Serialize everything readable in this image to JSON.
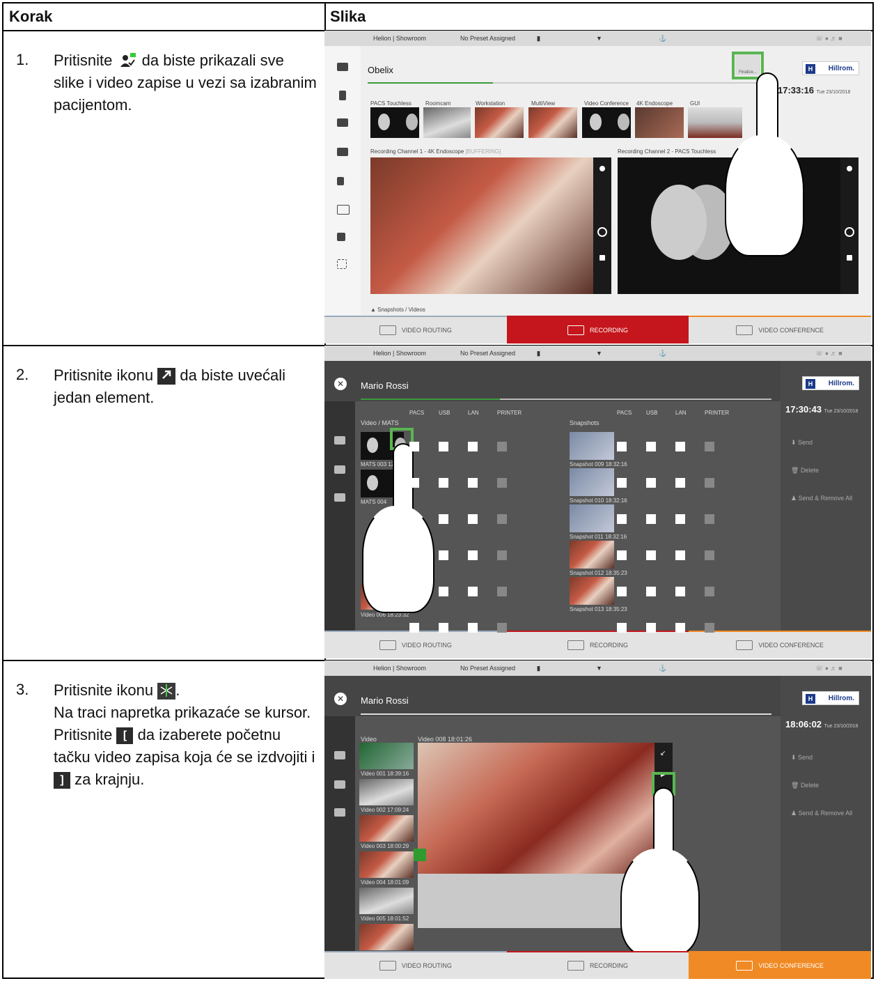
{
  "header": {
    "col_step": "Korak",
    "col_image": "Slika"
  },
  "rows": [
    {
      "num": "1.",
      "text_a": "Pritisnite",
      "text_b": "da biste prikazali sve slike i video zapise u vezi sa izabranim pacijentom.",
      "icon_label": "Finalize..."
    },
    {
      "num": "2.",
      "text_a": "Pritisnite ikonu",
      "text_b": "da biste uvećali jedan element."
    },
    {
      "num": "3.",
      "text_a": "Pritisnite ikonu",
      "text_b": ".",
      "text_c": "Na traci napretka prikazaće se kursor. Pritisnite",
      "text_d": "da izaberete početnu tačku video zapisa koja će se izdvojiti i",
      "text_e": "za krajnju."
    }
  ],
  "icons": {
    "finalize": "finalize-icon",
    "enlarge": "enlarge-icon",
    "cut": "scissors-icon",
    "mark_in": "[",
    "mark_out": "]"
  },
  "ui": {
    "topbar": {
      "location": "Helion | Showroom",
      "preset": "No Preset Assigned"
    },
    "tabs": {
      "routing": "VIDEO ROUTING",
      "recording": "RECORDING",
      "conference": "VIDEO CONFERENCE"
    },
    "brand": "Hillrom.",
    "shot1": {
      "patient": "Obelix",
      "clock": "17:33:16",
      "date": "Tue 23/10/2018",
      "finalize": "Finalize...",
      "sources": [
        "PACS Touchless",
        "Roomcam",
        "Workstation",
        "MultiView",
        "Video Conference",
        "4K Endoscope",
        "GUI"
      ],
      "channel1": "Recording Channel 1 - 4K Endoscope",
      "buffering": "[BUFFERING]",
      "channel2": "Recording Channel 2 - PACS Touchless",
      "snapshots": "Snapshots / Videos"
    },
    "shot2": {
      "patient": "Mario Rossi",
      "clock": "17:30:43",
      "date": "Tue 23/10/2018",
      "video_head": "Video / MATS",
      "snap_head": "Snapshots",
      "cols": [
        "PACS",
        "USB",
        "LAN",
        "PRINTER"
      ],
      "send": "Send",
      "delete": "Delete",
      "send_remove": "Send & Remove All",
      "item1": "MATS 003 12:09:34",
      "item2": "MATS 004",
      "snap_items": [
        "Snapshot 009 18:32:16",
        "Snapshot 010 18:32:16",
        "Snapshot 011 18:32:16",
        "Snapshot 012 18:35:23",
        "Snapshot 013 18:35:23"
      ],
      "video_item": "Video 006 18:23:32"
    },
    "shot3": {
      "patient": "Mario Rossi",
      "clock": "18:06:02",
      "date": "Tue 23/10/2018",
      "list_head": "Video",
      "video_title": "Video 008 18:01:26",
      "items": [
        "Video 001 18:39:16",
        "Video 002 17:09:24",
        "Video 003 18:00:29",
        "Video 004 18:01:09",
        "Video 005 18:01:52"
      ],
      "send": "Send",
      "delete": "Delete",
      "send_remove": "Send & Remove All"
    }
  }
}
